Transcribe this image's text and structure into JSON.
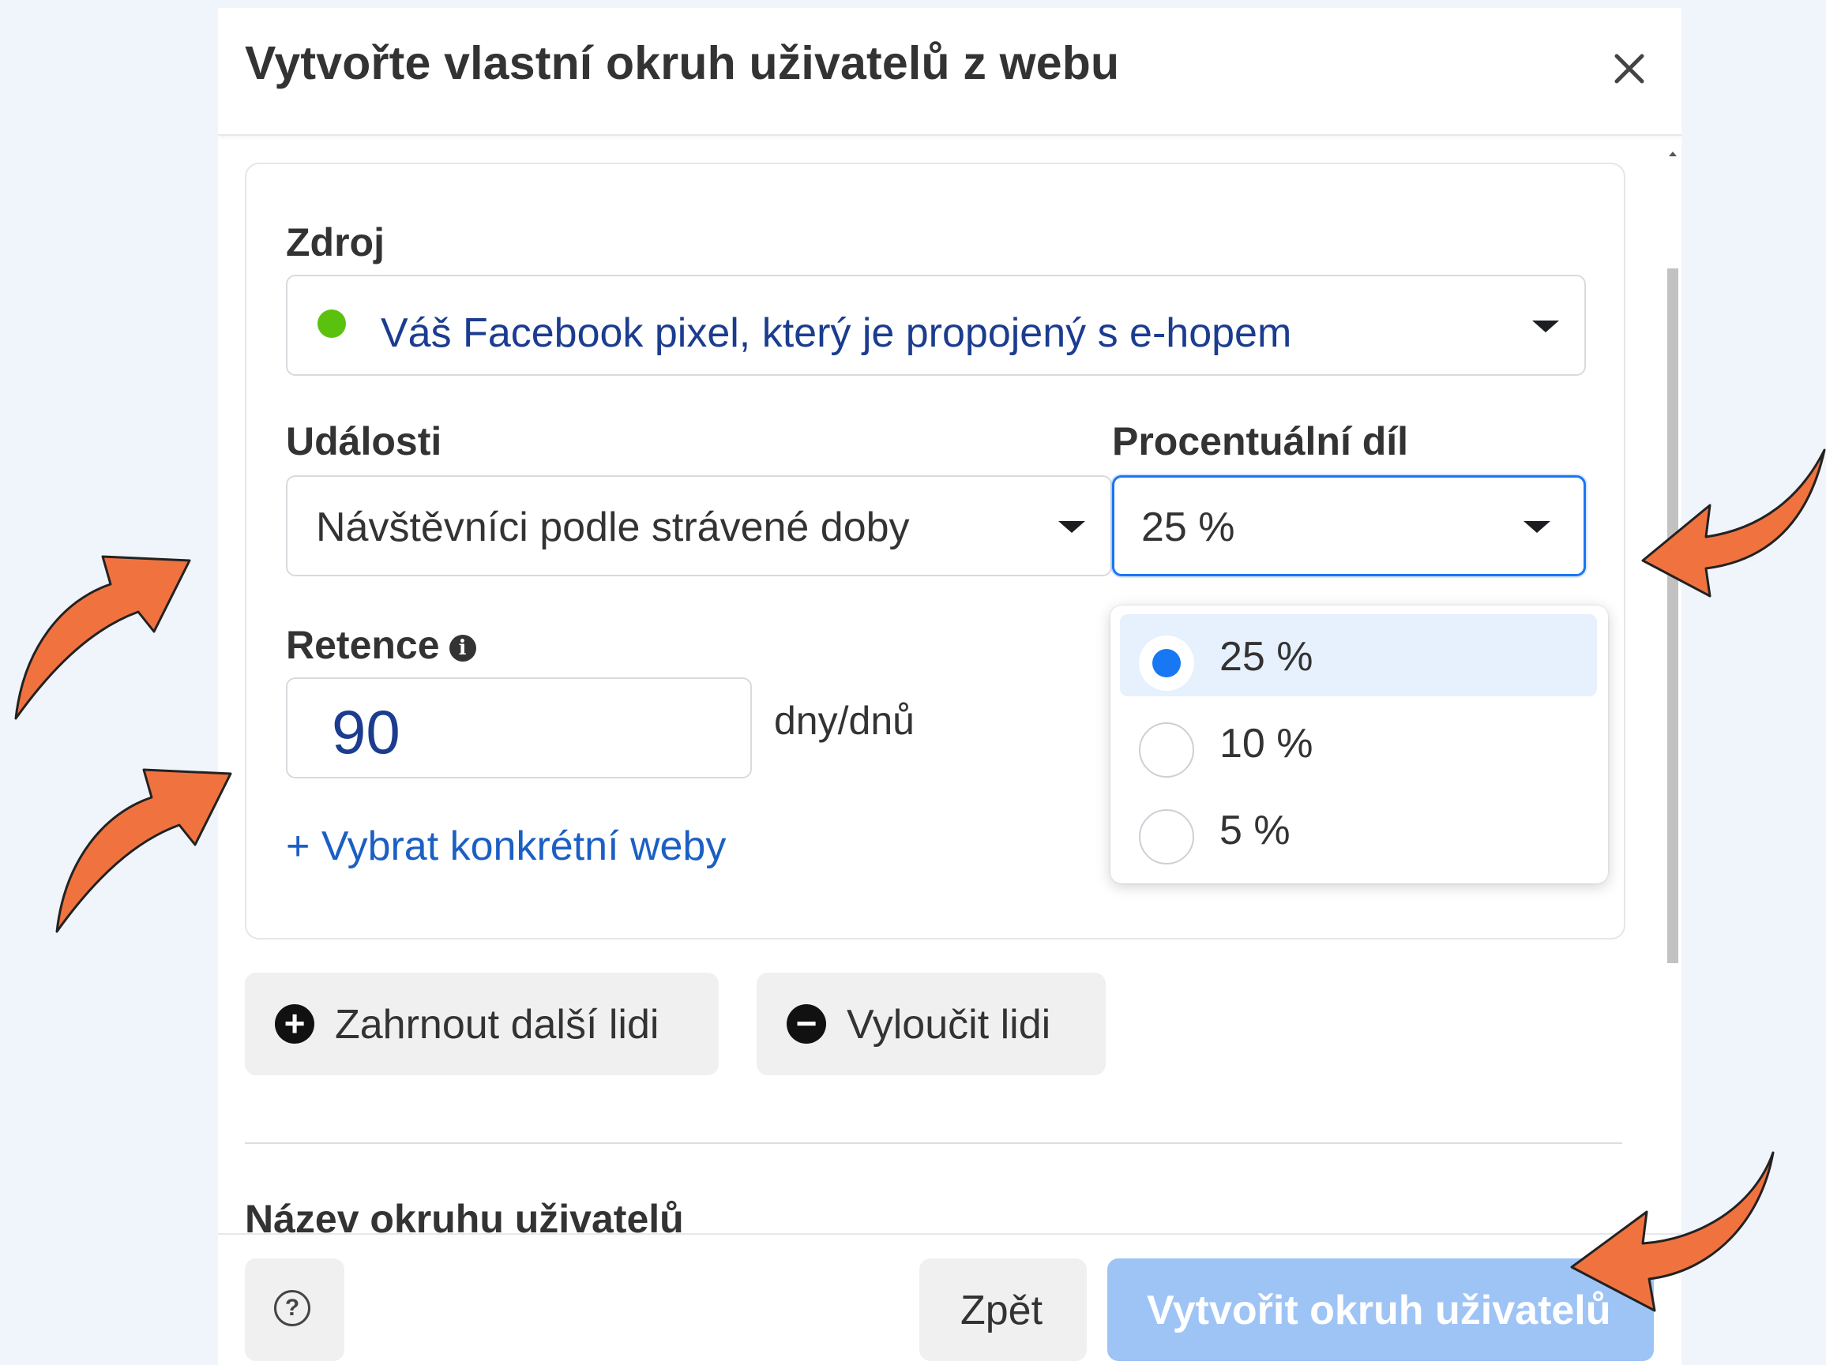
{
  "dialog": {
    "title": "Vytvořte vlastní okruh uživatelů z webu"
  },
  "source": {
    "label": "Zdroj",
    "value": "Váš Facebook pixel, který je propojený s e-hopem",
    "status_color": "#5ac20f"
  },
  "events": {
    "label": "Události",
    "value": "Návštěvníci podle strávené doby"
  },
  "percentage": {
    "label": "Procentuální díl",
    "value": "25 %",
    "options": [
      {
        "label": "25 %",
        "selected": true
      },
      {
        "label": "10 %",
        "selected": false
      },
      {
        "label": "5 %",
        "selected": false
      }
    ]
  },
  "retention": {
    "label": "Retence",
    "value": "90",
    "unit": "dny/dnů"
  },
  "select_websites_link": "+ Vybrat konkrétní weby",
  "include_button": "Zahrnout další lidi",
  "exclude_button": "Vyloučit lidi",
  "audience_name_label": "Název okruhu uživatelů",
  "footer": {
    "back_label": "Zpět",
    "create_label": "Vytvořit okruh uživatelů"
  },
  "colors": {
    "accent": "#1877f2",
    "annotation_arrow": "#f0733f",
    "primary_disabled": "#9ec4f5"
  }
}
